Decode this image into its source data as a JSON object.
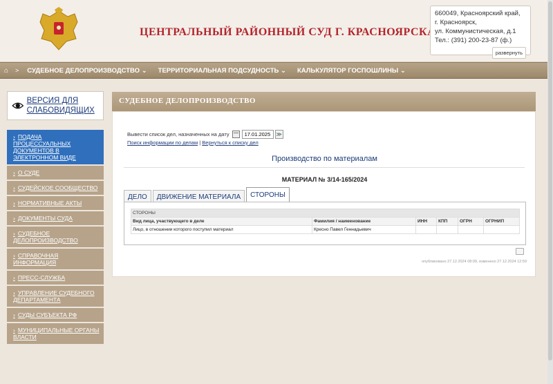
{
  "header": {
    "title": "ЦЕНТРАЛЬНЫЙ РАЙОННЫЙ СУД Г. КРАСНОЯРСКА",
    "contact_lines": [
      "660049, Красноярский край,",
      "г. Красноярск,",
      "ул. Коммунистическая, д.1",
      "Тел.: (391) 200-23-87 (ф.)"
    ],
    "expand_label": "развернуть"
  },
  "topnav": {
    "home_icon": "home-icon",
    "separator": ">",
    "items": [
      {
        "label": "СУДЕБНОЕ ДЕЛОПРОИЗВОДСТВО ⌄"
      },
      {
        "label": "ТЕРРИТОРИАЛЬНАЯ ПОДСУДНОСТЬ ⌄"
      },
      {
        "label": "КАЛЬКУЛЯТОР ГОСПОШЛИНЫ ⌄"
      }
    ]
  },
  "vision": {
    "label": "ВЕРСИЯ ДЛЯ СЛАБОВИДЯЩИХ",
    "icon": "eye-icon"
  },
  "sidebar": {
    "items": [
      {
        "label": "ПОДАЧА ПРОЦЕССУАЛЬНЫХ ДОКУМЕНТОВ В ЭЛЕКТРОННОМ ВИДЕ",
        "active": true
      },
      {
        "label": "О СУДЕ"
      },
      {
        "label": "СУДЕЙСКОЕ СООБЩЕСТВО"
      },
      {
        "label": "НОРМАТИВНЫЕ АКТЫ"
      },
      {
        "label": "ДОКУМЕНТЫ СУДА"
      },
      {
        "label": "СУДЕБНОЕ ДЕЛОПРОИЗВОДСТВО"
      },
      {
        "label": "СПРАВОЧНАЯ ИНФОРМАЦИЯ"
      },
      {
        "label": "ПРЕСС-СЛУЖБА"
      },
      {
        "label": "УПРАВЛЕНИЕ СУДЕБНОГО ДЕПАРТАМЕНТА"
      },
      {
        "label": "СУДЫ СУБЪЕКТА РФ"
      },
      {
        "label": "МУНИЦИПАЛЬНЫЕ ОРГАНЫ ВЛАСТИ"
      }
    ]
  },
  "main": {
    "panel_title": "СУДЕБНОЕ ДЕЛОПРОИЗВОДСТВО",
    "date_label": "Вывести список дел, назначенных на дату",
    "date_value": "17.01.2025",
    "go_label": "≫",
    "link_search": "Поиск информации по делам",
    "link_sep": "|",
    "link_back": "Вернуться к списку дел",
    "section_title": "Производство по материалам",
    "case_number": "МАТЕРИАЛ № 3/14-165/2024",
    "tabs": [
      {
        "label": "ДЕЛО"
      },
      {
        "label": "ДВИЖЕНИЕ МАТЕРИАЛА"
      },
      {
        "label": "СТОРОНЫ",
        "active": true
      }
    ],
    "table": {
      "caption": "СТОРОНЫ",
      "headers": [
        "Вид лица, участвующего в деле",
        "Фамилия / наименование",
        "ИНН",
        "КПП",
        "ОГРН",
        "ОГРНИП"
      ],
      "rows": [
        [
          "Лицо, в отношении которого поступил материал",
          "Кресно Павел Геннадьевич",
          "",
          "",
          "",
          ""
        ]
      ]
    },
    "print_icon": "printer-icon",
    "pub_info": "опубликовано 27.12.2024 08:09, изменено 27.12.2024 12:59"
  }
}
